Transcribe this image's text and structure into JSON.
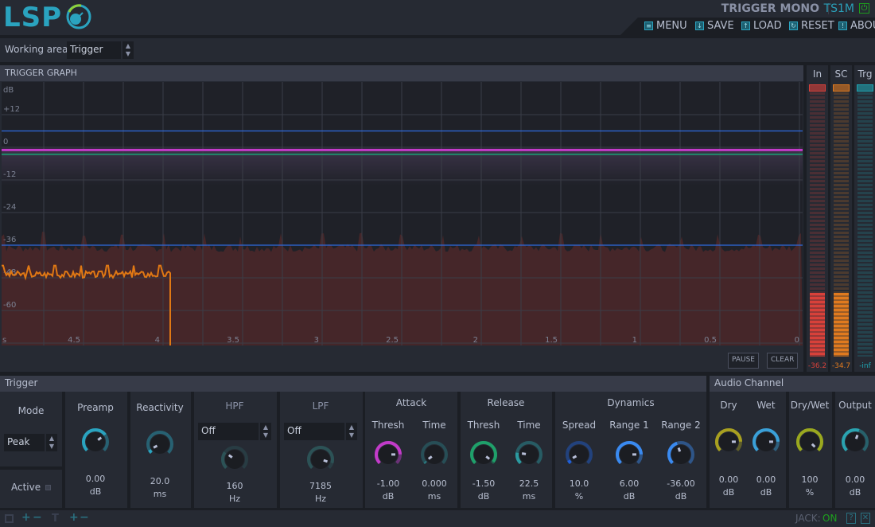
{
  "header": {
    "logo": "LSP",
    "plugin_title": "TRIGGER MONO",
    "plugin_code": "TS1M",
    "power_icon": "power-icon",
    "menu": [
      {
        "label": "MENU",
        "icon": "menu-icon"
      },
      {
        "label": "SAVE",
        "icon": "save-icon"
      },
      {
        "label": "LOAD",
        "icon": "load-icon"
      },
      {
        "label": "RESET",
        "icon": "reset-icon"
      },
      {
        "label": "ABOUT",
        "icon": "about-icon"
      }
    ]
  },
  "working_area": {
    "label": "Working area",
    "value": "Trigger"
  },
  "graph": {
    "title": "TRIGGER GRAPH",
    "y_unit": "dB",
    "y_ticks": [
      "+12",
      "0",
      "-12",
      "-24",
      "-36",
      "-48",
      "-60"
    ],
    "x_unit": "s",
    "x_ticks": [
      "4.5",
      "4",
      "3.5",
      "3",
      "2.5",
      "2",
      "1.5",
      "1",
      "0.5",
      "0"
    ],
    "pause": "PAUSE",
    "clear": "CLEAR",
    "colors": {
      "signal_fill": "#452629",
      "trigger_line": "#e07814",
      "threshold_lines": "#2f6be0",
      "attack_thresh": "#c23bc9",
      "release_thresh": "#1f8a6a"
    }
  },
  "meters": [
    {
      "label": "In",
      "value": "-36.2",
      "color": "#d8413a",
      "level": 0.6
    },
    {
      "label": "SC",
      "value": "-34.7",
      "color": "#e07a1f",
      "level": 0.6
    },
    {
      "label": "Trg",
      "value": "-inf",
      "color": "#1fa3b0",
      "level": 0
    }
  ],
  "trigger": {
    "title": "Trigger",
    "mode": {
      "label": "Mode",
      "value": "Peak"
    },
    "active": {
      "label": "Active"
    },
    "preamp": {
      "label": "Preamp",
      "value": "0.00",
      "unit": "dB",
      "level": 0.7,
      "color": "#2aa3bf"
    },
    "reactivity": {
      "label": "Reactivity",
      "value": "20.0",
      "unit": "ms",
      "level": 0.06,
      "color": "#2aa3bf"
    },
    "hpf": {
      "label": "HPF",
      "mode": "Off",
      "value": "160",
      "unit": "Hz",
      "level": 0.3,
      "color": "#2c5256"
    },
    "lpf": {
      "label": "LPF",
      "mode": "Off",
      "value": "7185",
      "unit": "Hz",
      "level": 0.9,
      "color": "#2c5256"
    },
    "attack": {
      "label": "Attack",
      "thresh": {
        "label": "Thresh",
        "value": "-1.00",
        "unit": "dB",
        "level": 0.83,
        "color": "#c23bc9"
      },
      "time": {
        "label": "Time",
        "value": "0.000",
        "unit": "ms",
        "level": 0.03,
        "color": "#2b7a80"
      }
    },
    "release": {
      "label": "Release",
      "thresh": {
        "label": "Thresh",
        "value": "-1.50",
        "unit": "dB",
        "level": 0.97,
        "color": "#1fa06a"
      },
      "time": {
        "label": "Time",
        "value": "22.5",
        "unit": "ms",
        "level": 0.2,
        "color": "#2b9aa0"
      }
    },
    "dynamics": {
      "label": "Dynamics",
      "spread": {
        "label": "Spread",
        "value": "10.0",
        "unit": "%",
        "level": 0.06,
        "color": "#1f5fd8"
      },
      "range1": {
        "label": "Range 1",
        "value": "6.00",
        "unit": "dB",
        "level": 0.83,
        "color": "#3a8af0"
      },
      "range2": {
        "label": "Range 2",
        "value": "-36.00",
        "unit": "dB",
        "level": 0.43,
        "color": "#3a8af0"
      }
    }
  },
  "audio_channel": {
    "title": "Audio Channel",
    "dry": {
      "label": "Dry",
      "value": "0.00",
      "unit": "dB",
      "level": 0.83,
      "color": "#a8a020"
    },
    "wet": {
      "label": "Wet",
      "value": "0.00",
      "unit": "dB",
      "level": 0.83,
      "color": "#3aa0d8"
    },
    "drywet": {
      "label": "Dry/Wet",
      "value": "100",
      "unit": "%",
      "level": 1.0,
      "color": "#9aa81f"
    },
    "output": {
      "label": "Output",
      "value": "0.00",
      "unit": "dB",
      "level": 0.57,
      "color": "#2aa3b0"
    }
  },
  "footer": {
    "jack_label": "JACK:",
    "jack_status": "ON"
  }
}
